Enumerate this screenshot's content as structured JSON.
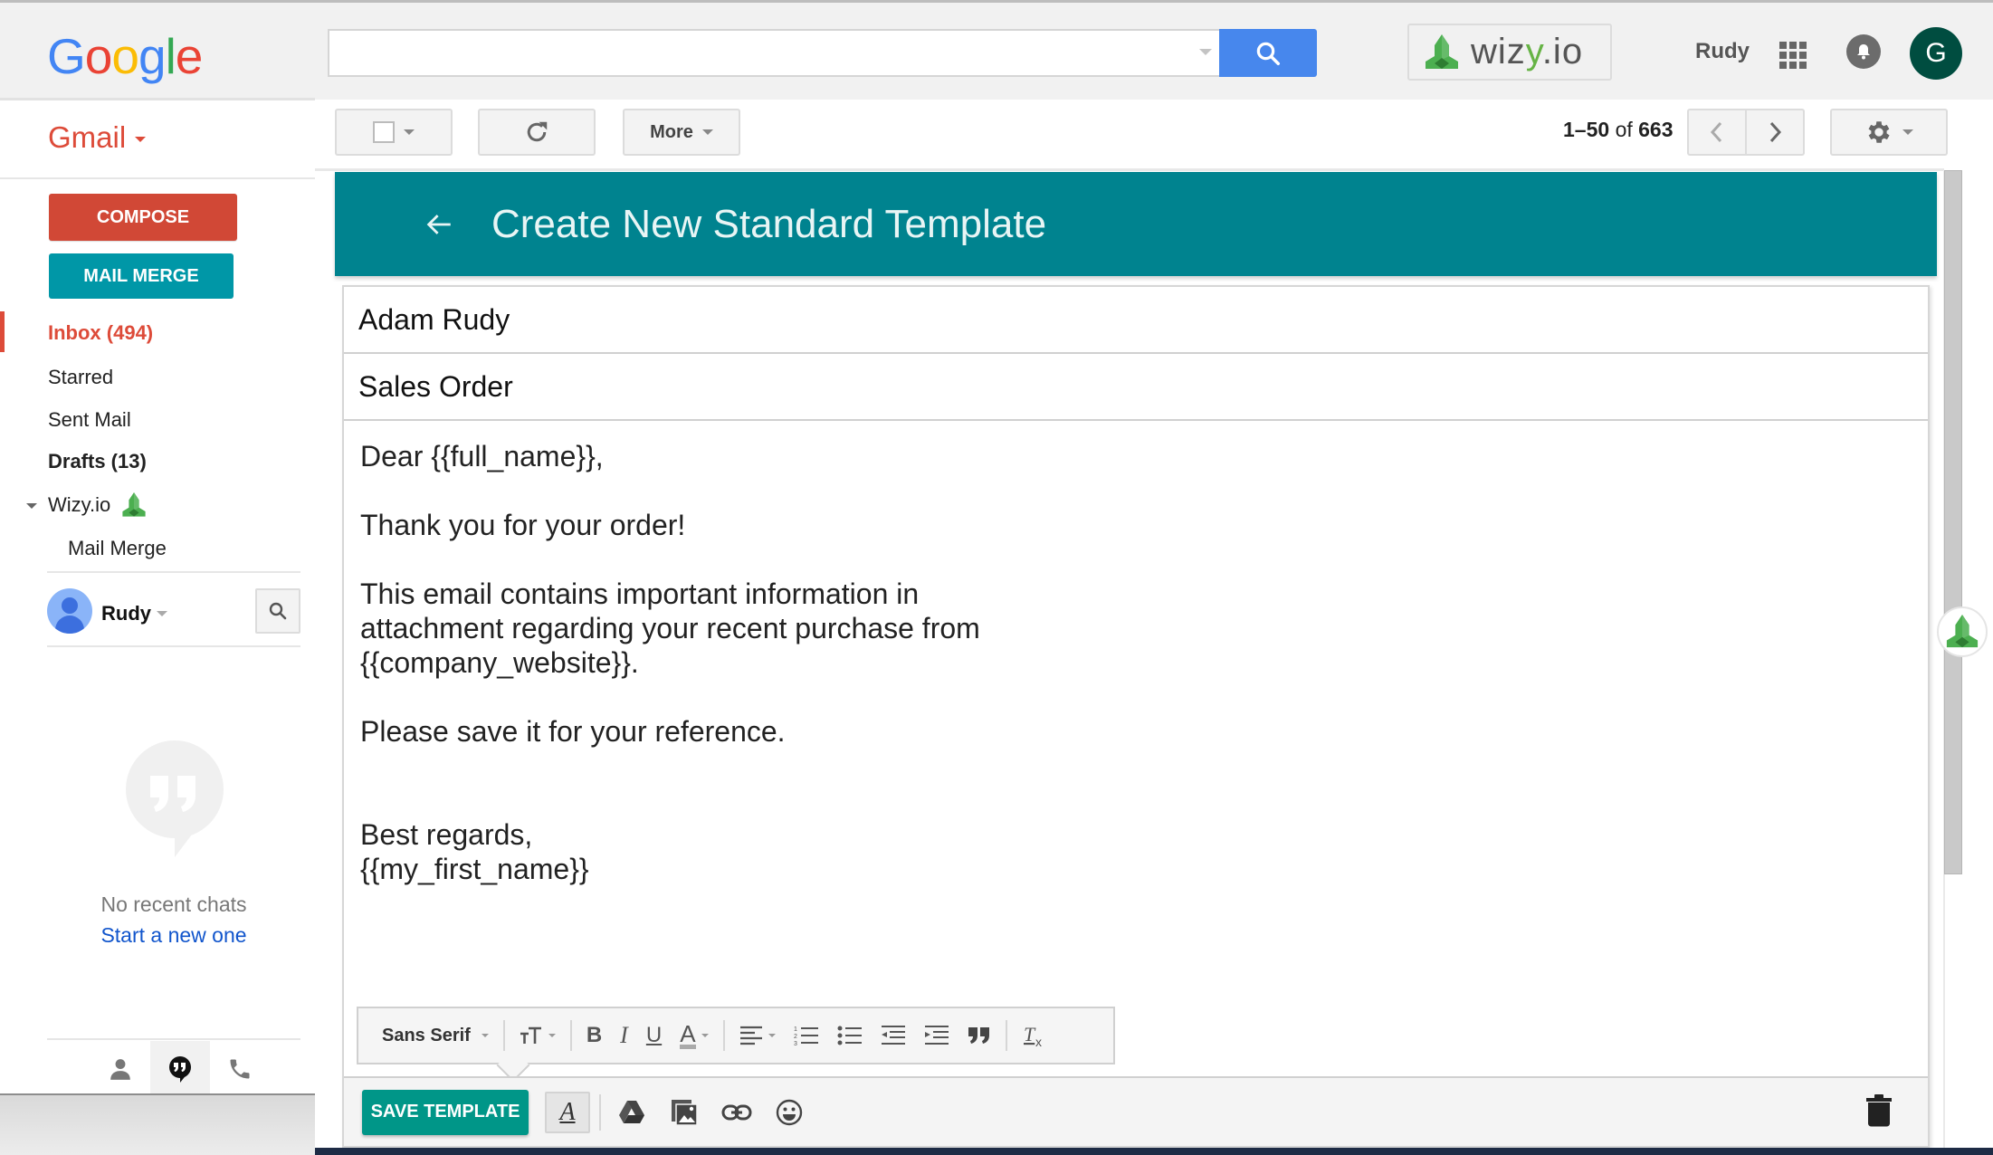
{
  "header": {
    "logo_letters": [
      {
        "char": "G",
        "color": "#4285f4"
      },
      {
        "char": "o",
        "color": "#ea4335"
      },
      {
        "char": "o",
        "color": "#fbbc05"
      },
      {
        "char": "g",
        "color": "#4285f4"
      },
      {
        "char": "l",
        "color": "#34a853"
      },
      {
        "char": "e",
        "color": "#ea4335"
      }
    ],
    "search_value": "",
    "search_placeholder": "",
    "wizy_logo": {
      "prefix": "wiz",
      "accent": "y",
      "suffix": ".io"
    },
    "user_name": "Rudy",
    "avatar_letter": "G",
    "icons": [
      "search-icon",
      "apps-grid-icon",
      "notifications-bell-icon"
    ]
  },
  "sidebar": {
    "app_label": "Gmail",
    "compose_label": "COMPOSE",
    "mail_merge_label": "MAIL MERGE",
    "nav": {
      "inbox": "Inbox (494)",
      "starred": "Starred",
      "sent": "Sent Mail",
      "drafts": "Drafts (13)",
      "wizy": "Wizy.io",
      "mail_merge": "Mail Merge"
    },
    "hangouts_user": "Rudy",
    "chat_empty": "No recent chats",
    "chat_start": "Start a new one"
  },
  "toolbar": {
    "more_label": "More",
    "page_range": "1–50",
    "page_of": "of",
    "page_total": "663"
  },
  "template": {
    "title": "Create New Standard Template",
    "to_field": "Adam Rudy",
    "subject_field": "Sales Order",
    "body_lines": [
      "Dear {{full_name}},",
      "",
      "Thank you for your order!",
      "",
      "This email contains important information in",
      "attachment regarding your recent purchase from",
      "{{company_website}}.",
      "",
      "Please save it for your reference.",
      "",
      "",
      "Best regards,",
      "{{my_first_name}}"
    ],
    "font_select": "Sans Serif",
    "save_label": "SAVE TEMPLATE"
  },
  "colors": {
    "gmail_red": "#dd4b39",
    "compose_red": "#d14836",
    "mail_merge_teal": "#0097a7",
    "header_teal": "#00838f",
    "save_green": "#009688",
    "search_blue": "#4787ed",
    "link_blue": "#1155cc"
  }
}
